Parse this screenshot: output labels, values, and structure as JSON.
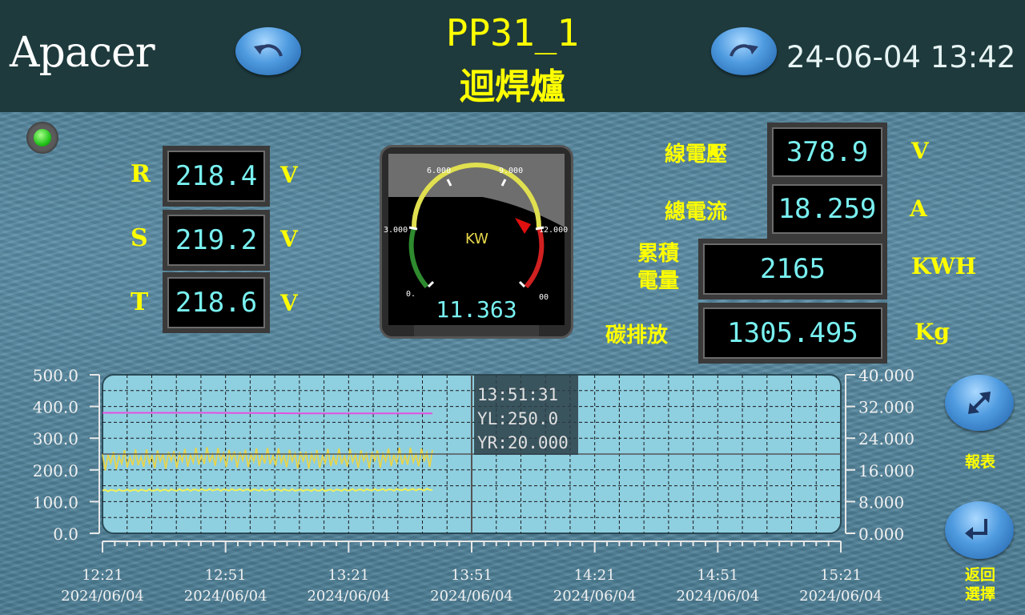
{
  "header": {
    "logo": "Apacer",
    "title_line1": "PP31_1",
    "title_line2": "迴焊爐",
    "datetime": "24-06-04 13:42"
  },
  "phase_voltages": [
    {
      "label": "R",
      "value": "218.4",
      "unit": "V"
    },
    {
      "label": "S",
      "value": "219.2",
      "unit": "V"
    },
    {
      "label": "T",
      "value": "218.6",
      "unit": "V"
    }
  ],
  "gauge": {
    "label": "KW",
    "value": "11.363",
    "ticks": [
      "0.",
      "3.000",
      "6.000",
      "9.000",
      "12.000",
      "00"
    ]
  },
  "metrics": {
    "line_voltage": {
      "label": "線電壓",
      "value": "378.9",
      "unit": "V"
    },
    "total_current": {
      "label": "總電流",
      "value": "18.259",
      "unit": "A"
    },
    "energy": {
      "label_line1": "累積",
      "label_line2": "電量",
      "value": "2165",
      "unit": "KWH"
    },
    "carbon": {
      "label": "碳排放",
      "value": "1305.495",
      "unit": "Kg"
    }
  },
  "trend": {
    "left_axis": [
      "500.0",
      "400.0",
      "300.0",
      "200.0",
      "100.0",
      "0.0"
    ],
    "right_axis": [
      "40.000",
      "32.000",
      "24.000",
      "16.000",
      "8.000",
      "0.000"
    ],
    "x_times": [
      "12:21",
      "12:51",
      "13:21",
      "13:51",
      "14:21",
      "14:51",
      "15:21"
    ],
    "x_date": "2024/06/04",
    "cursor_readout": {
      "time": "13:51:31",
      "yl": "YL:250.0",
      "yr": "YR:20.000"
    },
    "colors": {
      "magenta": "#e64fe0",
      "yellow_noisy": "#e8d44a",
      "yellow_flat": "#f0f05a",
      "plot_bg": "#8ecfe0"
    }
  },
  "chart_data": {
    "type": "line",
    "x": [
      "12:21",
      "12:51",
      "13:21",
      "13:51"
    ],
    "ylim_left": [
      0,
      500
    ],
    "ylim_right": [
      0,
      40
    ],
    "series": [
      {
        "values": [
          380,
          380,
          378,
          378
        ]
      },
      {
        "values": [
          230,
          240,
          235,
          240
        ]
      },
      {
        "values": [
          135,
          137,
          136,
          138
        ]
      }
    ]
  },
  "side_buttons": {
    "report": "報表",
    "back_line1": "返回",
    "back_line2": "選擇"
  }
}
